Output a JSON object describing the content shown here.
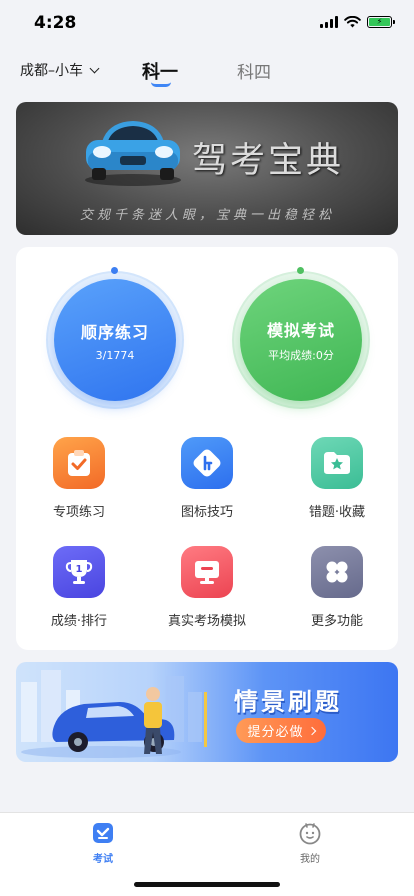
{
  "status_bar": {
    "time": "4:28",
    "battery_charging": true,
    "battery_color": "#34c759"
  },
  "top_nav": {
    "city": "成都–小车",
    "tabs": [
      {
        "label": "科一",
        "active": true
      },
      {
        "label": "科四",
        "active": false
      }
    ],
    "accent": "#3f86f5"
  },
  "banner": {
    "title": "驾考宝典",
    "slogan": "交规千条迷人眼，宝典一出稳轻松"
  },
  "practice": {
    "order": {
      "label": "顺序练习",
      "progress": "3/1774",
      "color": "#2f74ef"
    },
    "mock": {
      "label": "模拟考试",
      "avg_score": "平均成绩:0分",
      "color": "#3fb653"
    }
  },
  "features": [
    {
      "label": "专项练习",
      "icon": "clipboard-check-icon"
    },
    {
      "label": "图标技巧",
      "icon": "road-sign-icon"
    },
    {
      "label": "错题·收藏",
      "icon": "folder-star-icon"
    },
    {
      "label": "成绩·排行",
      "icon": "trophy-icon"
    },
    {
      "label": "真实考场模拟",
      "icon": "monitor-icon"
    },
    {
      "label": "更多功能",
      "icon": "grid-more-icon"
    }
  ],
  "promo": {
    "title": "情景刷题",
    "button": "提分必做"
  },
  "tab_bar": {
    "items": [
      {
        "label": "考试",
        "icon": "exam-icon",
        "active": true
      },
      {
        "label": "我的",
        "icon": "profile-face-icon",
        "active": false
      }
    ]
  }
}
